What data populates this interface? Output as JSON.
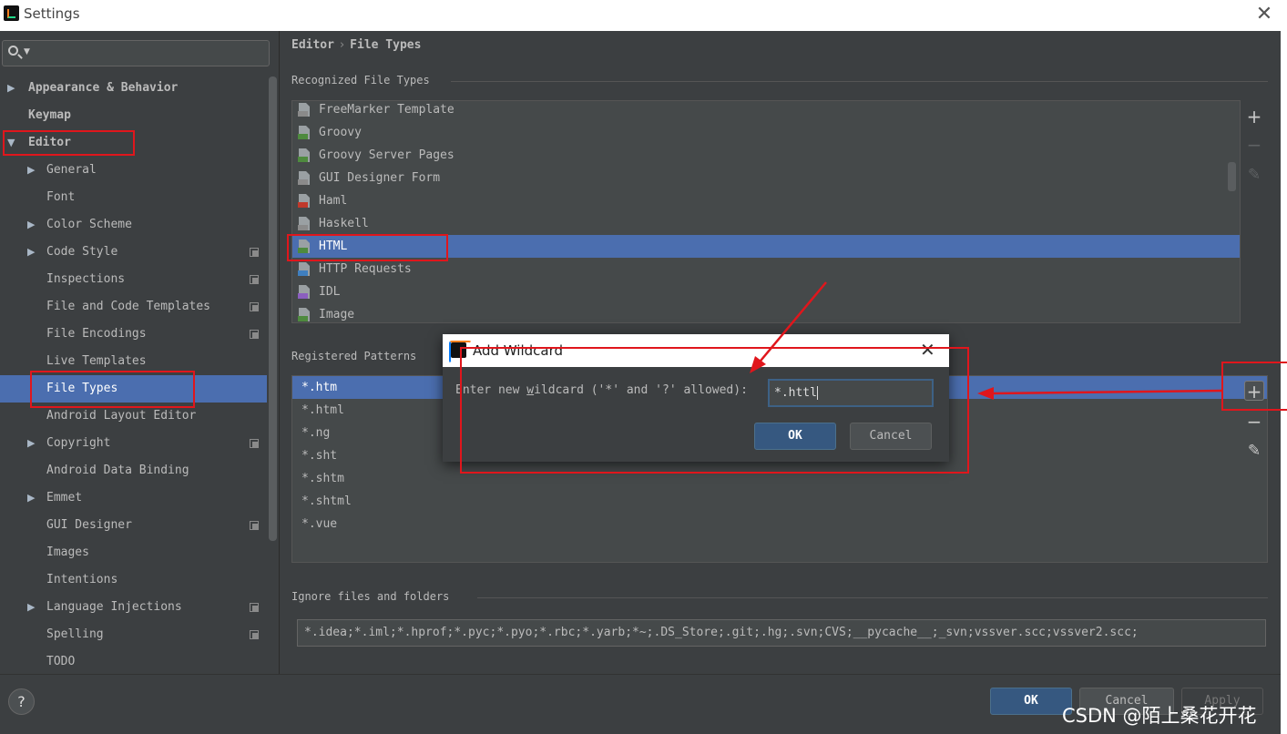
{
  "window": {
    "title": "Settings",
    "close_glyph": "✕"
  },
  "search": {
    "placeholder": "",
    "icon": "search-icon"
  },
  "sidebar": {
    "items": [
      {
        "label": "Appearance & Behavior",
        "arrow": "▶",
        "indent": 0,
        "bold": true,
        "icon": false,
        "selected": false
      },
      {
        "label": "Keymap",
        "arrow": "",
        "indent": 0,
        "bold": true,
        "icon": false,
        "selected": false
      },
      {
        "label": "Editor",
        "arrow": "▼",
        "indent": 0,
        "bold": true,
        "icon": false,
        "selected": false
      },
      {
        "label": "General",
        "arrow": "▶",
        "indent": 1,
        "bold": false,
        "icon": false,
        "selected": false
      },
      {
        "label": "Font",
        "arrow": "",
        "indent": 1,
        "bold": false,
        "icon": false,
        "selected": false
      },
      {
        "label": "Color Scheme",
        "arrow": "▶",
        "indent": 1,
        "bold": false,
        "icon": false,
        "selected": false
      },
      {
        "label": "Code Style",
        "arrow": "▶",
        "indent": 1,
        "bold": false,
        "icon": true,
        "selected": false
      },
      {
        "label": "Inspections",
        "arrow": "",
        "indent": 1,
        "bold": false,
        "icon": true,
        "selected": false
      },
      {
        "label": "File and Code Templates",
        "arrow": "",
        "indent": 1,
        "bold": false,
        "icon": true,
        "selected": false
      },
      {
        "label": "File Encodings",
        "arrow": "",
        "indent": 1,
        "bold": false,
        "icon": true,
        "selected": false
      },
      {
        "label": "Live Templates",
        "arrow": "",
        "indent": 1,
        "bold": false,
        "icon": false,
        "selected": false
      },
      {
        "label": "File Types",
        "arrow": "",
        "indent": 1,
        "bold": false,
        "icon": false,
        "selected": true
      },
      {
        "label": "Android Layout Editor",
        "arrow": "",
        "indent": 1,
        "bold": false,
        "icon": false,
        "selected": false
      },
      {
        "label": "Copyright",
        "arrow": "▶",
        "indent": 1,
        "bold": false,
        "icon": true,
        "selected": false
      },
      {
        "label": "Android Data Binding",
        "arrow": "",
        "indent": 1,
        "bold": false,
        "icon": false,
        "selected": false
      },
      {
        "label": "Emmet",
        "arrow": "▶",
        "indent": 1,
        "bold": false,
        "icon": false,
        "selected": false
      },
      {
        "label": "GUI Designer",
        "arrow": "",
        "indent": 1,
        "bold": false,
        "icon": true,
        "selected": false
      },
      {
        "label": "Images",
        "arrow": "",
        "indent": 1,
        "bold": false,
        "icon": false,
        "selected": false
      },
      {
        "label": "Intentions",
        "arrow": "",
        "indent": 1,
        "bold": false,
        "icon": false,
        "selected": false
      },
      {
        "label": "Language Injections",
        "arrow": "▶",
        "indent": 1,
        "bold": false,
        "icon": true,
        "selected": false
      },
      {
        "label": "Spelling",
        "arrow": "",
        "indent": 1,
        "bold": false,
        "icon": true,
        "selected": false
      },
      {
        "label": "TODO",
        "arrow": "",
        "indent": 1,
        "bold": false,
        "icon": false,
        "selected": false
      }
    ]
  },
  "breadcrumb": {
    "parent": "Editor",
    "separator": "›",
    "current": "File Types"
  },
  "recognized": {
    "title": "Recognized File Types",
    "items": [
      {
        "label": "FreeMarker Template",
        "icon": "freemarker-file-icon",
        "color": "#8a8a8a",
        "selected": false
      },
      {
        "label": "Groovy",
        "icon": "groovy-file-icon",
        "color": "#4e8a3e",
        "selected": false
      },
      {
        "label": "Groovy Server Pages",
        "icon": "gsp-file-icon",
        "color": "#4e8a3e",
        "selected": false
      },
      {
        "label": "GUI Designer Form",
        "icon": "form-file-icon",
        "color": "#8a8a8a",
        "selected": false
      },
      {
        "label": "Haml",
        "icon": "haml-file-icon",
        "color": "#c0392b",
        "selected": false
      },
      {
        "label": "Haskell",
        "icon": "haskell-file-icon",
        "color": "#8a8a8a",
        "selected": false
      },
      {
        "label": "HTML",
        "icon": "html-file-icon",
        "color": "#4e8a3e",
        "selected": true
      },
      {
        "label": "HTTP Requests",
        "icon": "http-file-icon",
        "color": "#3f7fbf",
        "selected": false
      },
      {
        "label": "IDL",
        "icon": "idl-file-icon",
        "color": "#8b5fbf",
        "selected": false
      },
      {
        "label": "Image",
        "icon": "image-file-icon",
        "color": "#4e8a3e",
        "selected": false
      }
    ]
  },
  "patterns": {
    "title": "Registered Patterns",
    "items": [
      "*.htm",
      "*.html",
      "*.ng",
      "*.sht",
      "*.shtm",
      "*.shtml",
      "*.vue"
    ],
    "selected_index": 0
  },
  "side_buttons": {
    "add": "+",
    "remove": "−",
    "edit": "✎"
  },
  "ignore": {
    "title": "Ignore files and folders",
    "value": "*.idea;*.iml;*.hprof;*.pyc;*.pyo;*.rbc;*.yarb;*~;.DS_Store;.git;.hg;.svn;CVS;__pycache__;_svn;vssver.scc;vssver2.scc;"
  },
  "dialog": {
    "title": "Add Wildcard",
    "prompt_before": "Enter new ",
    "prompt_mnemonic": "w",
    "prompt_after": "ildcard ('*' and '?' allowed):",
    "input_value": "*.httl",
    "ok": "OK",
    "cancel": "Cancel"
  },
  "footer": {
    "help": "?",
    "ok": "OK",
    "cancel": "Cancel",
    "apply": "Apply"
  },
  "watermark": "CSDN @陌上桑花开花",
  "colors": {
    "accent": "#4b6eaf",
    "annotation_red": "#e0161c",
    "background": "#3c3f41"
  }
}
